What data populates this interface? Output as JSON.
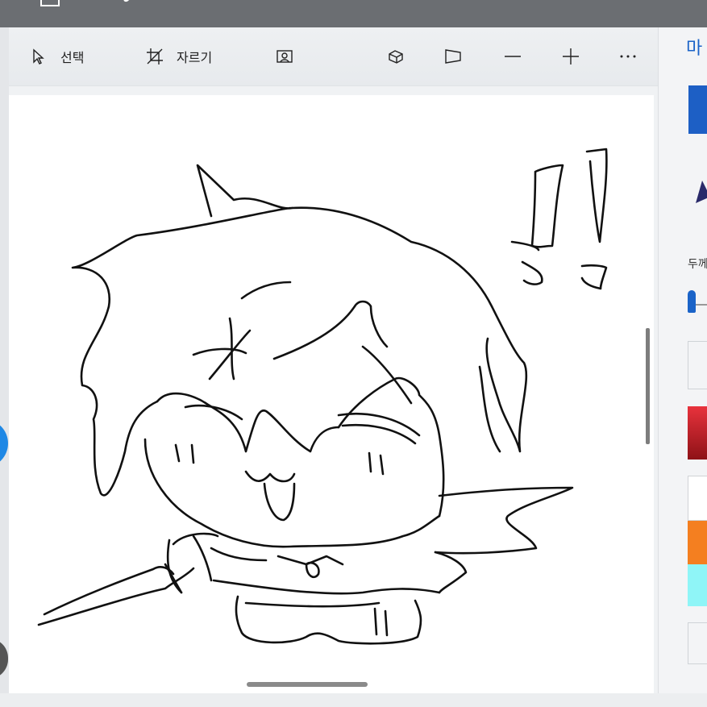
{
  "toolbar": {
    "select_label": "선택",
    "crop_label": "자르기"
  },
  "panel": {
    "title": "마",
    "thickness_label": "두께"
  },
  "colors": {
    "accent": "#1a63c8",
    "swatches": [
      "#d9252f",
      "#ffffff",
      "#f47f20",
      "#8ff5f7"
    ]
  },
  "icons": [
    "select-cursor-icon",
    "crop-icon",
    "magic-select-icon",
    "3d-view-icon",
    "sticker-icon",
    "zoom-out-icon",
    "zoom-in-icon",
    "more-icon"
  ]
}
